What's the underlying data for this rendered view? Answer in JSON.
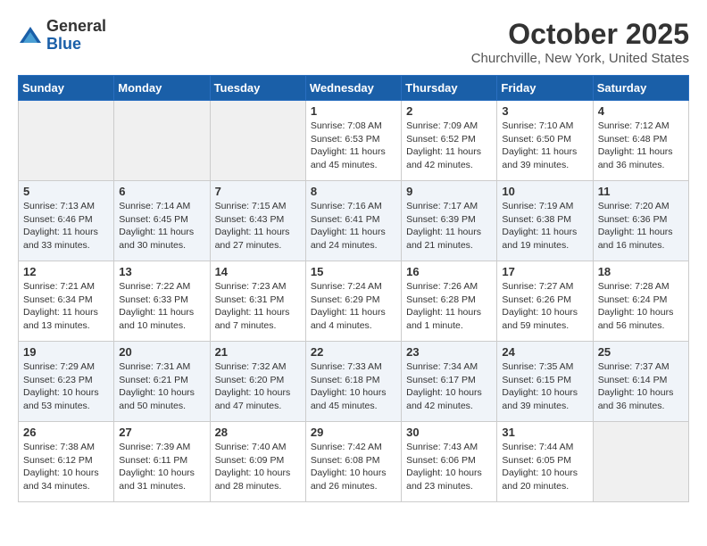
{
  "header": {
    "logo_general": "General",
    "logo_blue": "Blue",
    "month_title": "October 2025",
    "location": "Churchville, New York, United States"
  },
  "days_of_week": [
    "Sunday",
    "Monday",
    "Tuesday",
    "Wednesday",
    "Thursday",
    "Friday",
    "Saturday"
  ],
  "weeks": [
    [
      {
        "day": "",
        "info": ""
      },
      {
        "day": "",
        "info": ""
      },
      {
        "day": "",
        "info": ""
      },
      {
        "day": "1",
        "info": "Sunrise: 7:08 AM\nSunset: 6:53 PM\nDaylight: 11 hours\nand 45 minutes."
      },
      {
        "day": "2",
        "info": "Sunrise: 7:09 AM\nSunset: 6:52 PM\nDaylight: 11 hours\nand 42 minutes."
      },
      {
        "day": "3",
        "info": "Sunrise: 7:10 AM\nSunset: 6:50 PM\nDaylight: 11 hours\nand 39 minutes."
      },
      {
        "day": "4",
        "info": "Sunrise: 7:12 AM\nSunset: 6:48 PM\nDaylight: 11 hours\nand 36 minutes."
      }
    ],
    [
      {
        "day": "5",
        "info": "Sunrise: 7:13 AM\nSunset: 6:46 PM\nDaylight: 11 hours\nand 33 minutes."
      },
      {
        "day": "6",
        "info": "Sunrise: 7:14 AM\nSunset: 6:45 PM\nDaylight: 11 hours\nand 30 minutes."
      },
      {
        "day": "7",
        "info": "Sunrise: 7:15 AM\nSunset: 6:43 PM\nDaylight: 11 hours\nand 27 minutes."
      },
      {
        "day": "8",
        "info": "Sunrise: 7:16 AM\nSunset: 6:41 PM\nDaylight: 11 hours\nand 24 minutes."
      },
      {
        "day": "9",
        "info": "Sunrise: 7:17 AM\nSunset: 6:39 PM\nDaylight: 11 hours\nand 21 minutes."
      },
      {
        "day": "10",
        "info": "Sunrise: 7:19 AM\nSunset: 6:38 PM\nDaylight: 11 hours\nand 19 minutes."
      },
      {
        "day": "11",
        "info": "Sunrise: 7:20 AM\nSunset: 6:36 PM\nDaylight: 11 hours\nand 16 minutes."
      }
    ],
    [
      {
        "day": "12",
        "info": "Sunrise: 7:21 AM\nSunset: 6:34 PM\nDaylight: 11 hours\nand 13 minutes."
      },
      {
        "day": "13",
        "info": "Sunrise: 7:22 AM\nSunset: 6:33 PM\nDaylight: 11 hours\nand 10 minutes."
      },
      {
        "day": "14",
        "info": "Sunrise: 7:23 AM\nSunset: 6:31 PM\nDaylight: 11 hours\nand 7 minutes."
      },
      {
        "day": "15",
        "info": "Sunrise: 7:24 AM\nSunset: 6:29 PM\nDaylight: 11 hours\nand 4 minutes."
      },
      {
        "day": "16",
        "info": "Sunrise: 7:26 AM\nSunset: 6:28 PM\nDaylight: 11 hours\nand 1 minute."
      },
      {
        "day": "17",
        "info": "Sunrise: 7:27 AM\nSunset: 6:26 PM\nDaylight: 10 hours\nand 59 minutes."
      },
      {
        "day": "18",
        "info": "Sunrise: 7:28 AM\nSunset: 6:24 PM\nDaylight: 10 hours\nand 56 minutes."
      }
    ],
    [
      {
        "day": "19",
        "info": "Sunrise: 7:29 AM\nSunset: 6:23 PM\nDaylight: 10 hours\nand 53 minutes."
      },
      {
        "day": "20",
        "info": "Sunrise: 7:31 AM\nSunset: 6:21 PM\nDaylight: 10 hours\nand 50 minutes."
      },
      {
        "day": "21",
        "info": "Sunrise: 7:32 AM\nSunset: 6:20 PM\nDaylight: 10 hours\nand 47 minutes."
      },
      {
        "day": "22",
        "info": "Sunrise: 7:33 AM\nSunset: 6:18 PM\nDaylight: 10 hours\nand 45 minutes."
      },
      {
        "day": "23",
        "info": "Sunrise: 7:34 AM\nSunset: 6:17 PM\nDaylight: 10 hours\nand 42 minutes."
      },
      {
        "day": "24",
        "info": "Sunrise: 7:35 AM\nSunset: 6:15 PM\nDaylight: 10 hours\nand 39 minutes."
      },
      {
        "day": "25",
        "info": "Sunrise: 7:37 AM\nSunset: 6:14 PM\nDaylight: 10 hours\nand 36 minutes."
      }
    ],
    [
      {
        "day": "26",
        "info": "Sunrise: 7:38 AM\nSunset: 6:12 PM\nDaylight: 10 hours\nand 34 minutes."
      },
      {
        "day": "27",
        "info": "Sunrise: 7:39 AM\nSunset: 6:11 PM\nDaylight: 10 hours\nand 31 minutes."
      },
      {
        "day": "28",
        "info": "Sunrise: 7:40 AM\nSunset: 6:09 PM\nDaylight: 10 hours\nand 28 minutes."
      },
      {
        "day": "29",
        "info": "Sunrise: 7:42 AM\nSunset: 6:08 PM\nDaylight: 10 hours\nand 26 minutes."
      },
      {
        "day": "30",
        "info": "Sunrise: 7:43 AM\nSunset: 6:06 PM\nDaylight: 10 hours\nand 23 minutes."
      },
      {
        "day": "31",
        "info": "Sunrise: 7:44 AM\nSunset: 6:05 PM\nDaylight: 10 hours\nand 20 minutes."
      },
      {
        "day": "",
        "info": ""
      }
    ]
  ]
}
